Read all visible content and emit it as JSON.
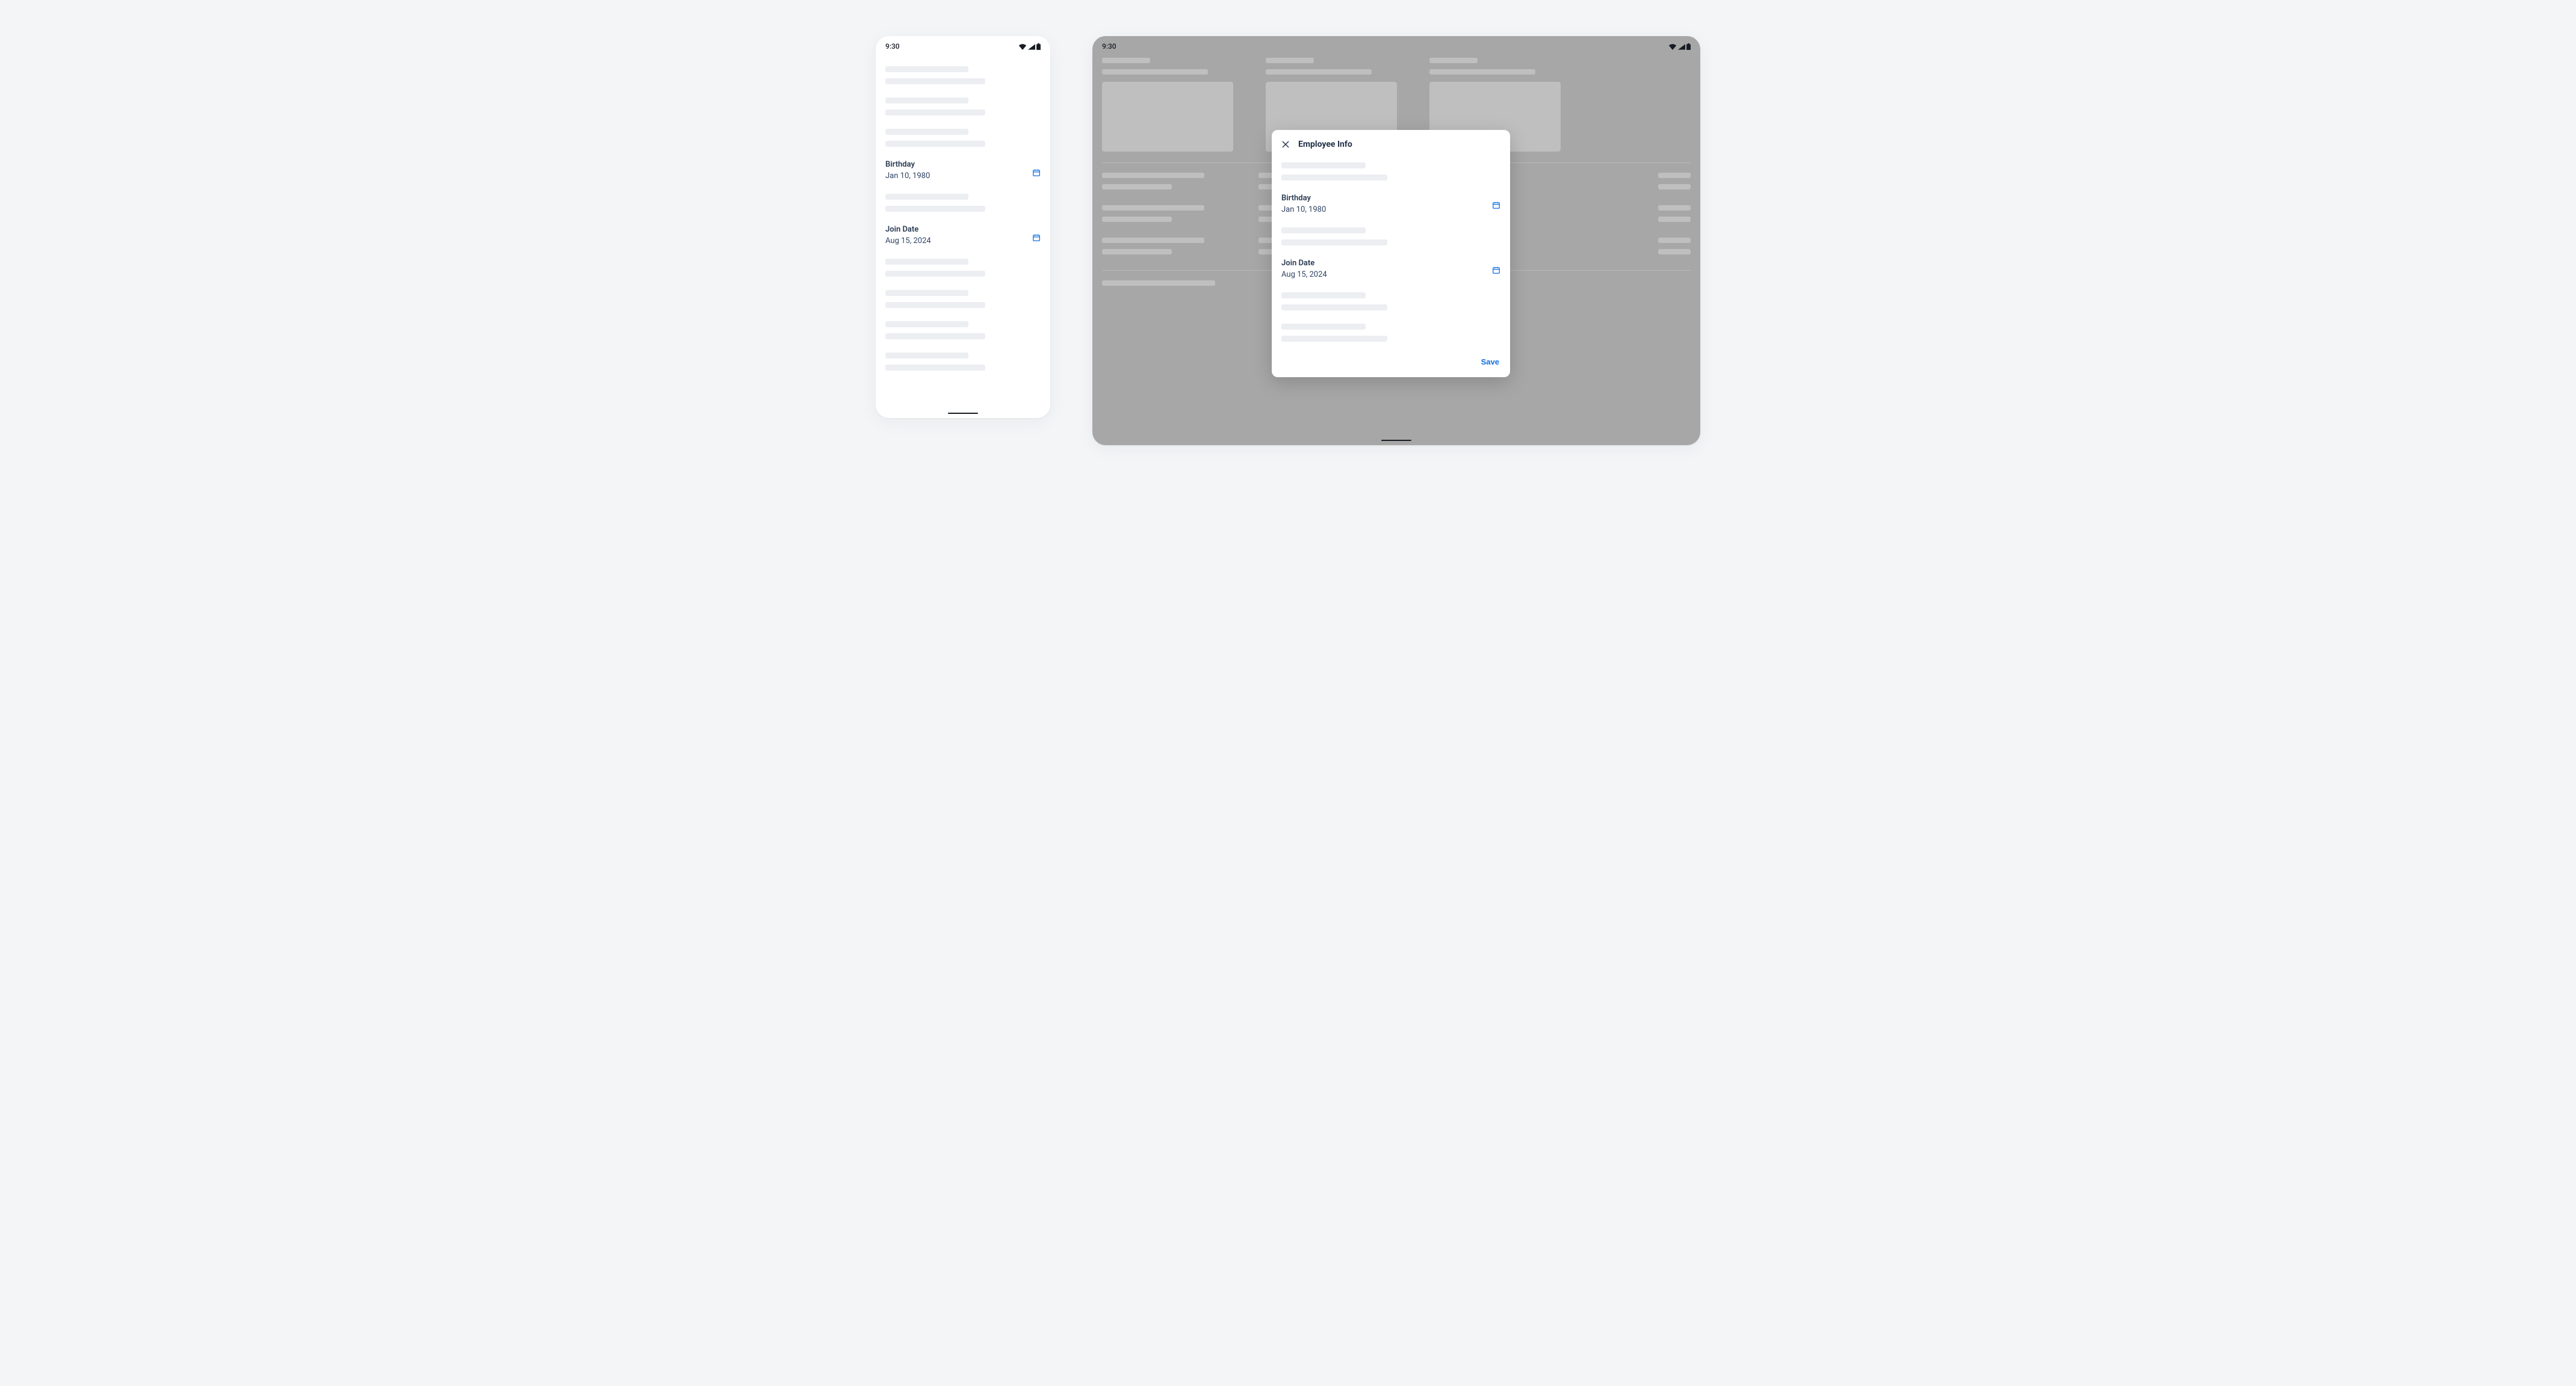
{
  "colors": {
    "accent": "#1070e4",
    "text": "#23314a"
  },
  "status_time": "9:30",
  "phone": {
    "birthday": {
      "label": "Birthday",
      "value": "Jan 10, 1980"
    },
    "joindate": {
      "label": "Join Date",
      "value": "Aug 15, 2024"
    }
  },
  "dialog": {
    "title": "Employee Info",
    "birthday": {
      "label": "Birthday",
      "value": "Jan 10, 1980"
    },
    "joindate": {
      "label": "Join Date",
      "value": "Aug 15, 2024"
    },
    "save_label": "Save"
  },
  "icons": {
    "close": "close-icon",
    "calendar": "calendar-icon",
    "wifi": "wifi-icon",
    "signal": "signal-icon",
    "battery": "battery-icon"
  }
}
